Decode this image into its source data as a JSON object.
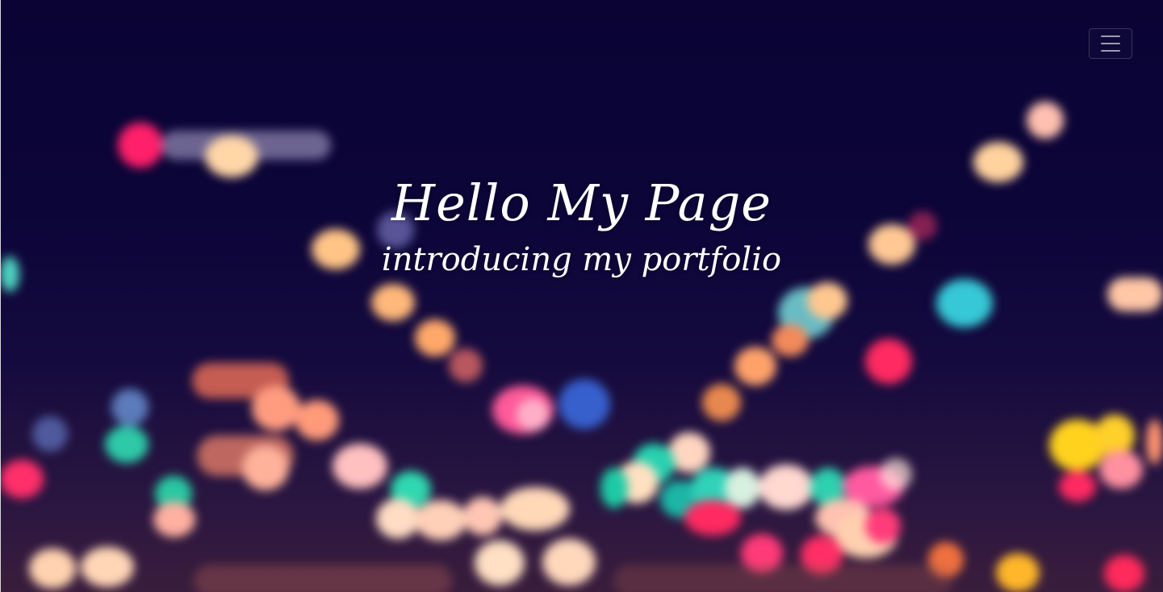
{
  "hero": {
    "title": "Hello My Page",
    "subtitle": "introducing my portfolio",
    "background_style": "blurred city lights bokeh at night",
    "colors": {
      "background": "#0b0433",
      "text": "#ffffff"
    }
  },
  "navbar": {
    "menu_toggle_icon": "hamburger-menu-icon"
  }
}
